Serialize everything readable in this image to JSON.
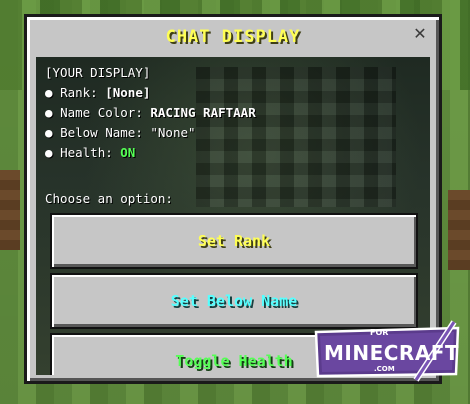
{
  "dialog": {
    "title": "CHAT DISPLAY",
    "close_glyph": "✕"
  },
  "display": {
    "header": "[YOUR DISPLAY]",
    "bullet": "●",
    "rank_label": "Rank: ",
    "rank_value": "[None]",
    "name_color_label": "Name Color: ",
    "name_color_value": "RACING RAFTAAR",
    "below_name_label": "Below Name: ",
    "below_name_value": "\"None\"",
    "health_label": "Health: ",
    "health_value": "ON"
  },
  "prompt": "Choose an option:",
  "buttons": {
    "set_rank": "Set Rank",
    "set_below_name": "Set Below Name",
    "toggle_health": "Toggle Health"
  },
  "colors": {
    "title": "#ffff55",
    "set_rank": "#ffff55",
    "set_below_name": "#55ffff",
    "toggle_health": "#55ff55",
    "health_on": "#55ff55"
  },
  "watermark": {
    "top": "FOR",
    "main": "MINECRAFT",
    "bottom": ".COM"
  }
}
